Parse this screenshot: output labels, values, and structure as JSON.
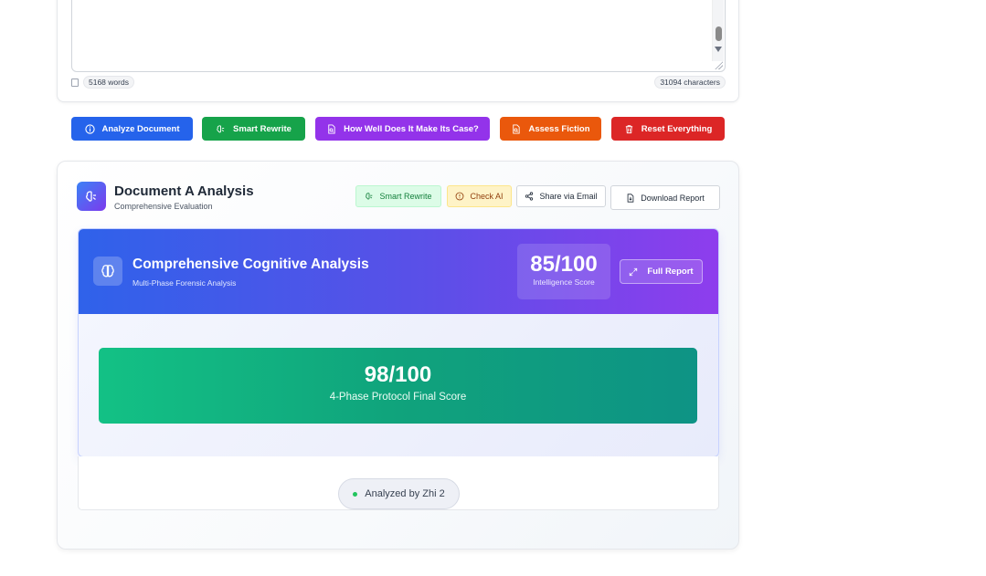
{
  "editor": {
    "word_count": "5168 words",
    "char_count": "31094 characters"
  },
  "actions": {
    "analyze": "Analyze Document",
    "smart_rewrite": "Smart Rewrite",
    "make_case": "How Well Does It Make Its Case?",
    "assess_fiction": "Assess Fiction",
    "reset": "Reset Everything",
    "colors": {
      "analyze": "#2563eb",
      "smart_rewrite": "#16a34a",
      "make_case": "#9333ea",
      "assess_fiction": "#ea580c",
      "reset": "#dc2626"
    }
  },
  "analysis": {
    "title": "Document A Analysis",
    "subtitle": "Comprehensive Evaluation",
    "header_buttons": {
      "smart_rewrite": "Smart Rewrite",
      "check_ai": "Check AI",
      "share_email": "Share via Email",
      "download_report": "Download Report"
    },
    "banner": {
      "title": "Comprehensive Cognitive Analysis",
      "subtitle": "Multi-Phase Forensic Analysis",
      "score": "85/100",
      "score_label": "Intelligence Score",
      "full_report": "Full Report"
    },
    "final": {
      "score": "98/100",
      "label": "4-Phase Protocol Final Score"
    },
    "analyzed_by": "Analyzed by Zhi 2"
  }
}
